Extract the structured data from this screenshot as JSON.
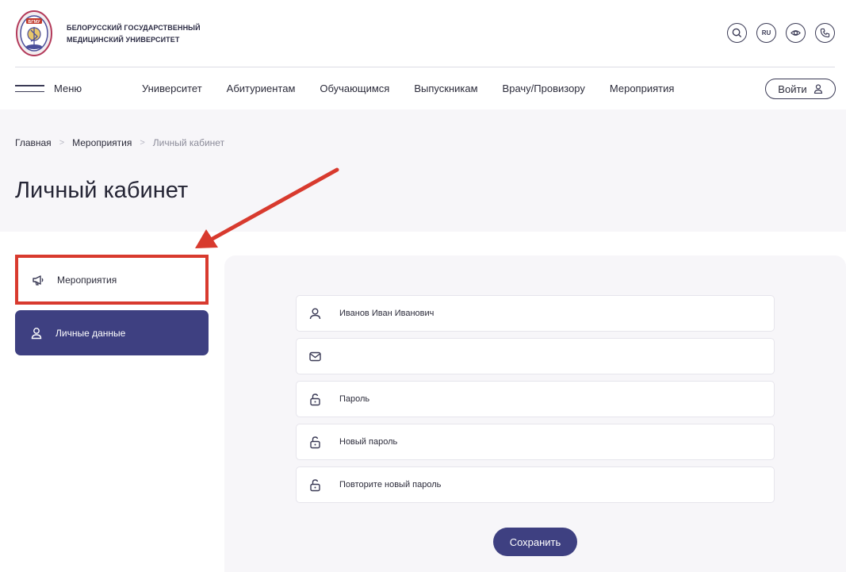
{
  "header": {
    "brand_line1": "БЕЛОРУССКИЙ ГОСУДАРСТВЕННЫЙ",
    "brand_line2": "МЕДИЦИНСКИЙ УНИВЕРСИТЕТ",
    "logo_text": "БГМУ",
    "lang": "RU",
    "icons": [
      "search-icon",
      "language-icon",
      "eye-icon",
      "phone-icon"
    ]
  },
  "nav": {
    "menu_label": "Меню",
    "items": [
      "Университет",
      "Абитуриентам",
      "Обучающимся",
      "Выпускникам",
      "Врачу/Провизору",
      "Мероприятия"
    ],
    "login_label": "Войти"
  },
  "breadcrumb": {
    "items": [
      "Главная",
      "Мероприятия",
      "Личный кабинет"
    ],
    "separator": ">"
  },
  "page": {
    "title": "Личный кабинет"
  },
  "sidebar": {
    "items": [
      {
        "label": "Мероприятия",
        "icon": "megaphone-icon",
        "highlighted": true
      },
      {
        "label": "Личные данные",
        "icon": "user-icon",
        "active": true
      }
    ]
  },
  "form": {
    "name_value": "Иванов Иван Иванович",
    "email_value": "",
    "password_placeholder": "Пароль",
    "new_password_placeholder": "Новый пароль",
    "repeat_password_placeholder": "Повторите новый пароль",
    "save_label": "Сохранить"
  },
  "colors": {
    "accent": "#3e4081",
    "highlight_border": "#d83a2e",
    "hero_background": "#f7f6f9"
  }
}
